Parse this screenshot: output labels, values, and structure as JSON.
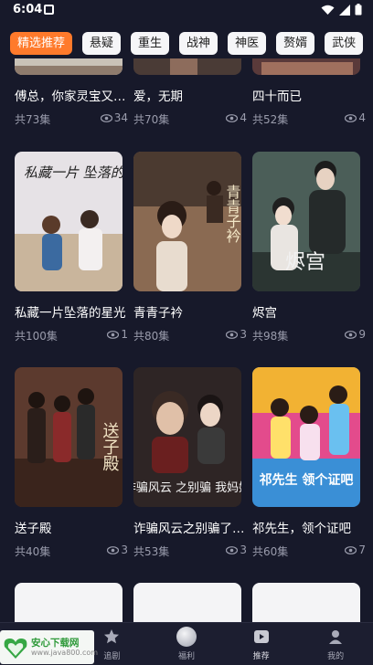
{
  "status": {
    "time": "6:04"
  },
  "tabs": [
    "精选推荐",
    "悬疑",
    "重生",
    "战神",
    "神医",
    "赘婿",
    "武侠"
  ],
  "rows": [
    [
      {
        "title": "傅总，你家灵宝又闯祸了",
        "episodes": "共73集",
        "views": "34",
        "color": "#c9c2b8"
      },
      {
        "title": "爱，无期",
        "episodes": "共70集",
        "views": "4",
        "color": "#4a3b36"
      },
      {
        "title": "四十而已",
        "episodes": "共52集",
        "views": "4",
        "color": "#5a3a3a"
      }
    ],
    [
      {
        "title": "私藏一片坠落的星光",
        "episodes": "共100集",
        "views": "1",
        "color": "#e3dde0"
      },
      {
        "title": "青青子衿",
        "episodes": "共80集",
        "views": "3",
        "color": "#7a5a45"
      },
      {
        "title": "烬宫",
        "episodes": "共98集",
        "views": "9",
        "color": "#3b4b46"
      }
    ],
    [
      {
        "title": "送子殿",
        "episodes": "共40集",
        "views": "3",
        "color": "#5c3a2e"
      },
      {
        "title": "诈骗风云之别骗了我妈妈",
        "episodes": "共53集",
        "views": "3",
        "color": "#2e2525"
      },
      {
        "title": "祁先生，领个证吧",
        "episodes": "共60集",
        "views": "7",
        "color": "#3a8fd6"
      }
    ]
  ],
  "poster_text": {
    "r1c0": "私藏一片 坠落的星光",
    "r1c1": "青青子衿",
    "r1c2": "烬宫",
    "r2c0": "送子殿",
    "r2c1": "诈骗风云 之别骗 我妈妈",
    "r2c2": "祁先生 领个证吧"
  },
  "nav": [
    {
      "label": "追剧",
      "icon": "star-icon"
    },
    {
      "label": "福利",
      "icon": "gift-orb-icon"
    },
    {
      "label": "推荐",
      "icon": "play-icon"
    },
    {
      "label": "我的",
      "icon": "user-icon"
    }
  ],
  "watermark": {
    "title": "安心下载网",
    "url": "www.java800.com"
  }
}
